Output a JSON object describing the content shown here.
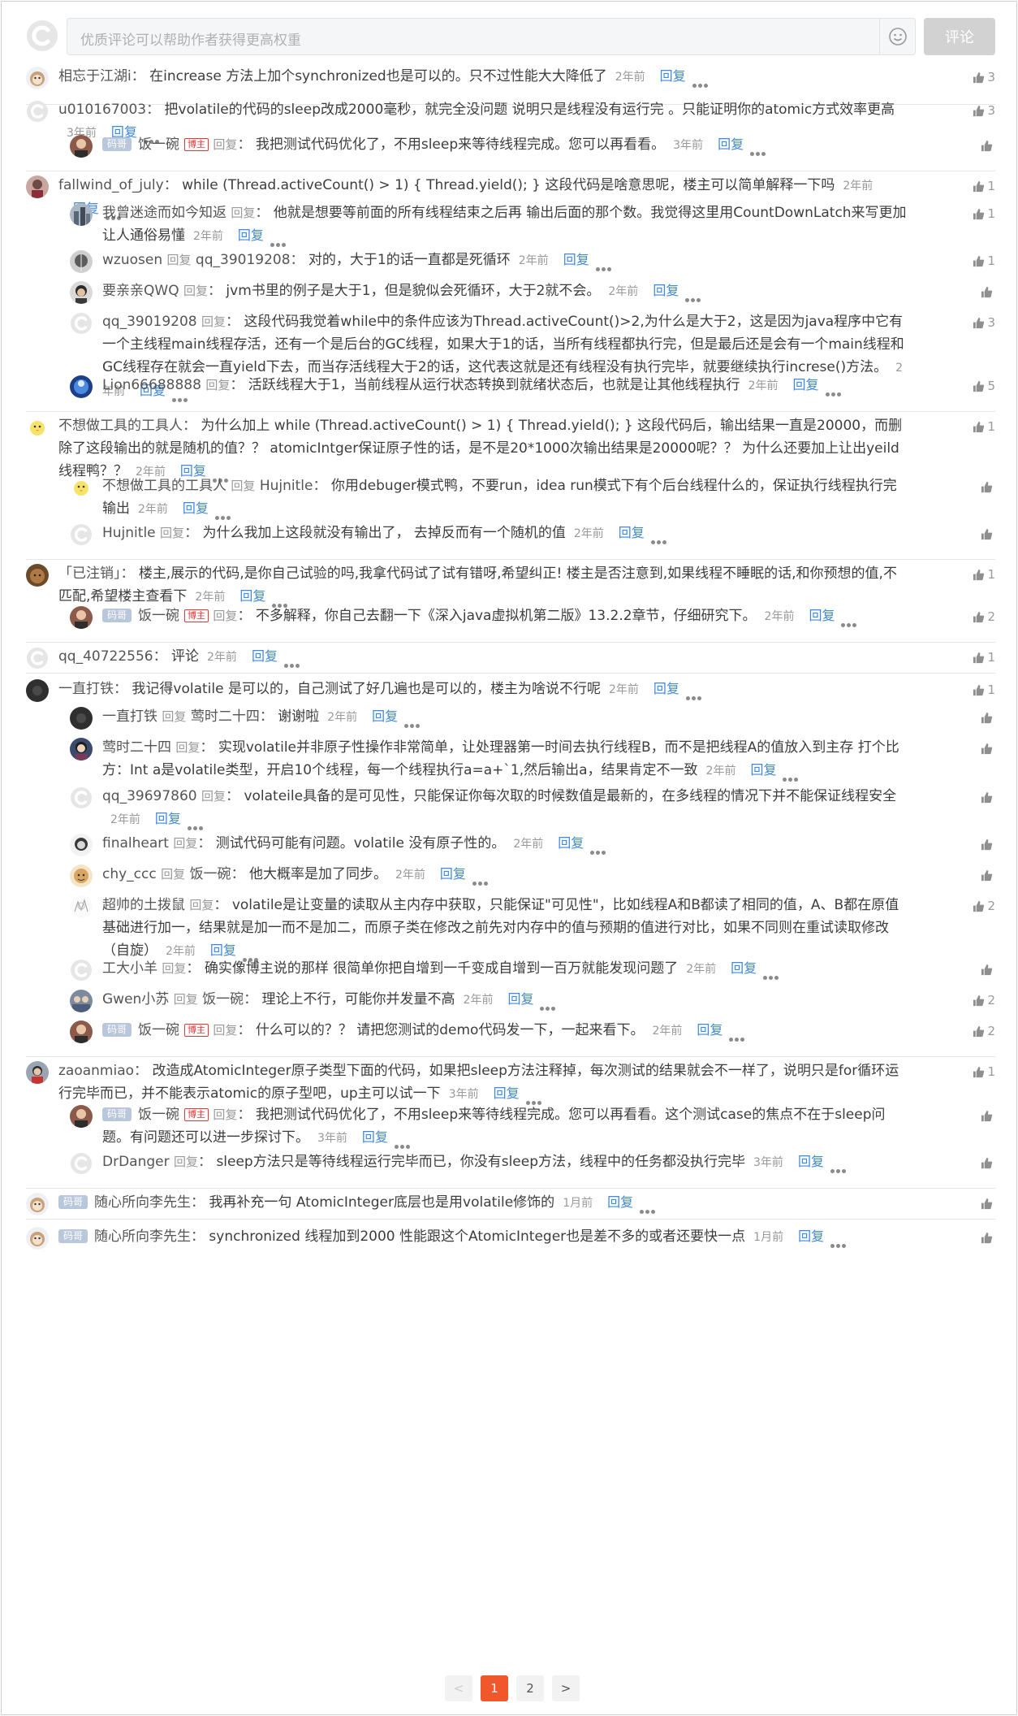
{
  "input": {
    "placeholder": "优质评论可以帮助作者获得更高权重",
    "submit_label": "评论"
  },
  "common": {
    "reply": "回复",
    "reply_word": "回复",
    "badge": "码哥",
    "author_tag": "博主"
  },
  "comments": [
    {
      "name": "相忘于江湖i",
      "text": "在increase 方法上加个synchronized也是可以的。只不过性能大大降低了",
      "time": "2年前",
      "likes": "3"
    },
    {
      "name": "u010167003",
      "text": "把volatile的代码的sleep改成2000毫秒，就完全没问题 说明只是线程没有运行完 。只能证明你的atomic方式效率更高",
      "time": "3年前",
      "likes": "3"
    },
    {
      "name": "饭一碗",
      "text": "我把测试代码优化了，不用sleep来等待线程完成。您可以再看看。",
      "time": "3年前",
      "likes": ""
    },
    {
      "name": "fallwind_of_july",
      "text": "while (Thread.activeCount() > 1) { Thread.yield(); } 这段代码是啥意思呢，楼主可以简单解释一下吗",
      "time": "2年前",
      "likes": "1"
    },
    {
      "name": "我曾迷途而如今知返",
      "text": "他就是想要等前面的所有线程结束之后再 输出后面的那个数。我觉得这里用CountDownLatch来写更加让人通俗易懂",
      "time": "2年前",
      "likes": "1"
    },
    {
      "name": "wzuosen",
      "target": "qq_39019208",
      "text": "对的，大于1的话一直都是死循环",
      "time": "2年前",
      "likes": "1"
    },
    {
      "name": "要亲亲QWQ",
      "text": "jvm书里的例子是大于1，但是貌似会死循环，大于2就不会。",
      "time": "2年前",
      "likes": ""
    },
    {
      "name": "qq_39019208",
      "text": "这段代码我觉着while中的条件应该为Thread.activeCount()>2,为什么是大于2，这是因为java程序中它有一个主线程main线程存活，还有一个是后台的GC线程，如果大于1的话，当所有线程都执行完，但是最后还是会有一个main线程和GC线程存在就会一直yield下去，而当存活线程大于2的话，这代表这就是还有线程没有执行完毕，就要继续执行increse()方法。",
      "time": "2年前",
      "likes": "3"
    },
    {
      "name": "Lion66688888",
      "text": "活跃线程大于1，当前线程从运行状态转换到就绪状态后，也就是让其他线程执行",
      "time": "2年前",
      "likes": "5"
    },
    {
      "name": "不想做工具的工具人",
      "text": "为什么加上 while (Thread.activeCount() > 1) { Thread.yield(); } 这段代码后，输出结果一直是20000，而删除了这段输出的就是随机的值？？ atomicIntger保证原子性的话，是不是20*1000次输出结果是20000呢？？ 为什么还要加上让出yeild线程鸭？？",
      "time": "2年前",
      "likes": "1"
    },
    {
      "name": "不想做工具的工具人",
      "target": "Hujnitle",
      "text": "你用debuger模式鸭，不要run，idea run模式下有个后台线程什么的，保证执行线程执行完输出",
      "time": "2年前",
      "likes": ""
    },
    {
      "name": "Hujnitle",
      "text": "为什么我加上这段就没有输出了， 去掉反而有一个随机的值",
      "time": "2年前",
      "likes": ""
    },
    {
      "name": "「已注销」",
      "text": "楼主,展示的代码,是你自己试验的吗,我拿代码试了试有错呀,希望纠正! 楼主是否注意到,如果线程不睡眠的话,和你预想的值,不匹配,希望楼主查看下",
      "time": "2年前",
      "likes": "1"
    },
    {
      "name": "饭一碗",
      "text": "不多解释，你自己去翻一下《深入java虚拟机第二版》13.2.2章节，仔细研究下。",
      "time": "2年前",
      "likes": "2"
    },
    {
      "name": "qq_40722556",
      "text": "评论",
      "time": "2年前",
      "likes": "1"
    },
    {
      "name": "一直打铁",
      "text": "我记得volatile 是可以的，自己测试了好几遍也是可以的，楼主为啥说不行呢",
      "time": "2年前",
      "likes": "1"
    },
    {
      "name": "一直打铁",
      "target": "莺时二十四",
      "text": "谢谢啦",
      "time": "2年前",
      "likes": ""
    },
    {
      "name": "莺时二十四",
      "text": "实现volatile并非原子性操作非常简单，让处理器第一时间去执行线程B，而不是把线程A的值放入到主存 打个比方：Int a是volatile类型，开启10个线程，每一个线程执行a=a+`1,然后输出a，结果肯定不一致",
      "time": "2年前",
      "likes": ""
    },
    {
      "name": "qq_39697860",
      "text": "volateile具备的是可见性，只能保证你每次取的时候数值是最新的，在多线程的情况下并不能保证线程安全",
      "time": "2年前",
      "likes": ""
    },
    {
      "name": "finalheart",
      "text": "测试代码可能有问题。volatile 没有原子性的。",
      "time": "2年前",
      "likes": ""
    },
    {
      "name": "chy_ccc",
      "target": "饭一碗",
      "text": "他大概率是加了同步。",
      "time": "2年前",
      "likes": ""
    },
    {
      "name": "超帅的土拨鼠",
      "text": "volatile是让变量的读取从主内存中获取，只能保证\"可见性\"，比如线程A和B都读了相同的值，A、B都在原值基础进行加一，结果就是加一而不是加二，而原子类在修改之前先对内存中的值与预期的值进行对比，如果不同则在重试读取修改（自旋）",
      "time": "2年前",
      "likes": "2"
    },
    {
      "name": "工大小羊",
      "text": "确实像博主说的那样 很简单你把自增到一千变成自增到一百万就能发现问题了",
      "time": "2年前",
      "likes": ""
    },
    {
      "name": "Gwen小苏",
      "target": "饭一碗",
      "text": "理论上不行，可能你并发量不高",
      "time": "2年前",
      "likes": "2"
    },
    {
      "name": "饭一碗",
      "text": "什么可以的？？ 请把您测试的demo代码发一下，一起来看下。",
      "time": "2年前",
      "likes": "2"
    },
    {
      "name": "zaoanmiao",
      "text": "改造成AtomicInteger原子类型下面的代码，如果把sleep方法注释掉，每次测试的结果就会不一样了，说明只是for循环运行完毕而已，并不能表示atomic的原子型吧，up主可以试一下",
      "time": "3年前",
      "likes": "1"
    },
    {
      "name": "饭一碗",
      "text": "我把测试代码优化了，不用sleep来等待线程完成。您可以再看看。这个测试case的焦点不在于sleep问题。有问题还可以进一步探讨下。",
      "time": "3年前",
      "likes": ""
    },
    {
      "name": "DrDanger",
      "text": "sleep方法只是等待线程运行完毕而已，你没有sleep方法，线程中的任务都没执行完毕",
      "time": "3年前",
      "likes": ""
    },
    {
      "name": "随心所向李先生",
      "text": "我再补充一句 AtomicInteger底层也是用volatile修饰的",
      "time": "1月前",
      "likes": ""
    },
    {
      "name": "随心所向李先生",
      "text": "synchronized 线程加到2000 性能跟这个AtomicInteger也是差不多的或者还要快一点",
      "time": "1月前",
      "likes": ""
    }
  ],
  "pagination": {
    "prev": "<",
    "pages": [
      "1",
      "2"
    ],
    "next": ">",
    "current": "1"
  },
  "colors": {
    "link": "#3f88e0",
    "accent": "#f0582c",
    "badge": "#b9c7dc",
    "author": "#ee3333"
  }
}
